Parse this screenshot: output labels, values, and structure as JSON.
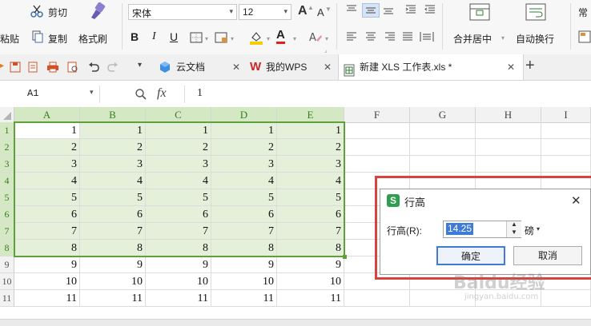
{
  "ribbon": {
    "cut": "剪切",
    "paste": "粘贴",
    "copy": "复制",
    "format_painter": "格式刷",
    "font_name": "宋体",
    "font_size": "12",
    "bold": "B",
    "italic": "I",
    "underline": "U",
    "font_grow": "A",
    "font_shrink": "A",
    "font_color": "A",
    "merge_center": "合并居中",
    "wrap_text": "自动换行",
    "normal_style": "常"
  },
  "tabs": {
    "cloud_docs": "云文档",
    "my_wps": "我的WPS",
    "workbook": "新建 XLS 工作表.xls *"
  },
  "formula_bar": {
    "cell_ref": "A1",
    "fx": "fx",
    "value": "1"
  },
  "grid": {
    "columns": [
      "A",
      "B",
      "C",
      "D",
      "E",
      "F",
      "G",
      "H",
      "I"
    ],
    "selected_columns": [
      "A",
      "B",
      "C",
      "D",
      "E"
    ],
    "selected_rows": [
      1,
      2,
      3,
      4,
      5,
      6,
      7,
      8
    ],
    "rows": [
      {
        "num": "1",
        "vals": [
          "1",
          "1",
          "1",
          "1",
          "1"
        ]
      },
      {
        "num": "2",
        "vals": [
          "2",
          "2",
          "2",
          "2",
          "2"
        ]
      },
      {
        "num": "3",
        "vals": [
          "3",
          "3",
          "3",
          "3",
          "3"
        ]
      },
      {
        "num": "4",
        "vals": [
          "4",
          "4",
          "4",
          "4",
          "4"
        ]
      },
      {
        "num": "5",
        "vals": [
          "5",
          "5",
          "5",
          "5",
          "5"
        ]
      },
      {
        "num": "6",
        "vals": [
          "6",
          "6",
          "6",
          "6",
          "6"
        ]
      },
      {
        "num": "7",
        "vals": [
          "7",
          "7",
          "7",
          "7",
          "7"
        ]
      },
      {
        "num": "8",
        "vals": [
          "8",
          "8",
          "8",
          "8",
          "8"
        ]
      },
      {
        "num": "9",
        "vals": [
          "9",
          "9",
          "9",
          "9",
          "9"
        ]
      },
      {
        "num": "10",
        "vals": [
          "10",
          "10",
          "10",
          "10",
          "10"
        ]
      },
      {
        "num": "11",
        "vals": [
          "11",
          "11",
          "11",
          "11",
          "11"
        ]
      }
    ]
  },
  "dialog": {
    "title": "行高",
    "label": "行高(R):",
    "value": "14.25",
    "unit": "磅",
    "ok": "确定",
    "cancel": "取消",
    "close": "✕"
  },
  "watermark": {
    "brand": "Baidu经验",
    "url": "jingyan.baidu.com"
  },
  "colors": {
    "selection_fill": "#e4f0d9",
    "selection_border": "#5f9f3c",
    "highlight_frame": "#d9423e",
    "wps_red": "#c8282a",
    "dialog_icon": "#2e9e4f"
  }
}
